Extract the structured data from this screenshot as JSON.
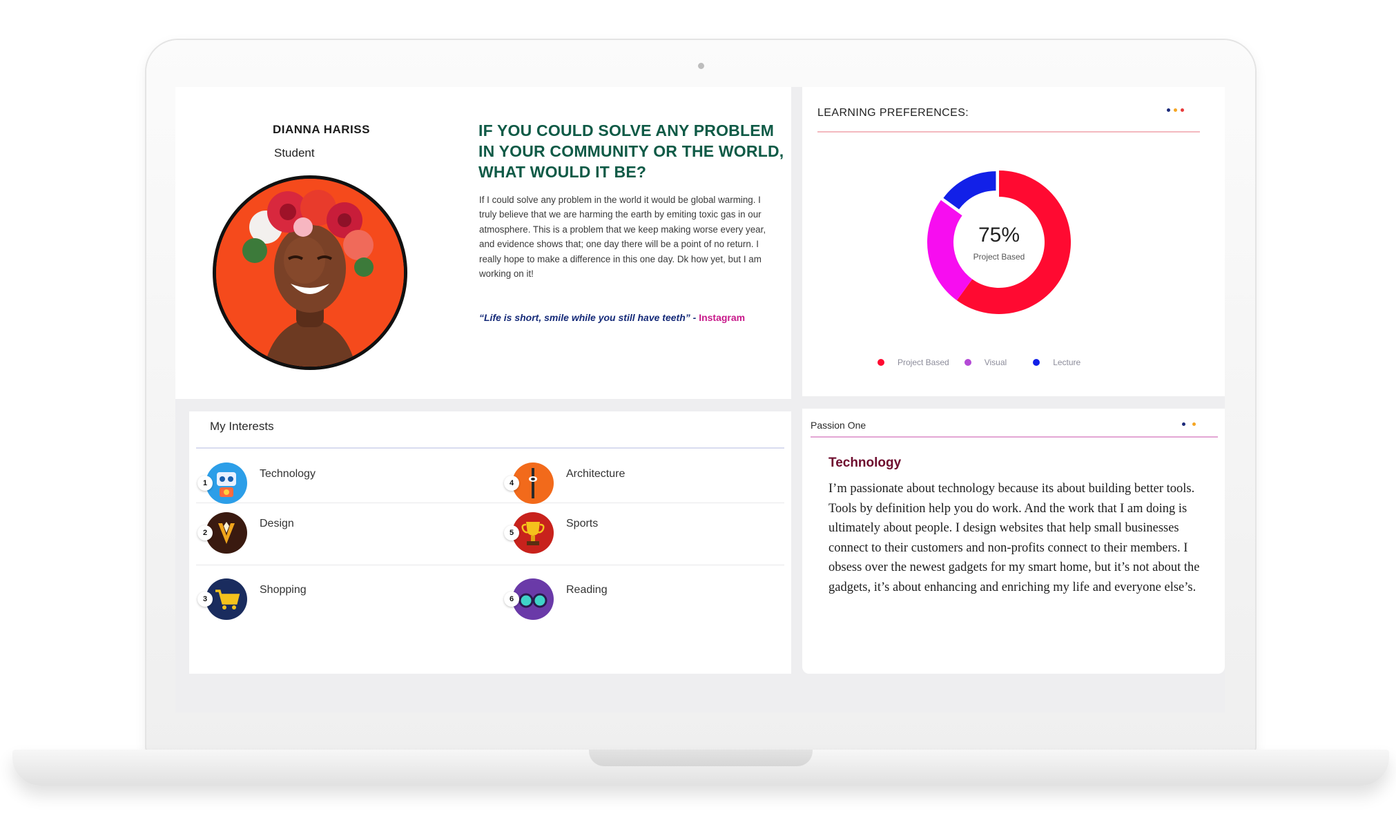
{
  "profile": {
    "name": "DIANNA HARISS",
    "role": "Student",
    "question": "IF YOU COULD SOLVE ANY PROBLEM IN YOUR COMMUNITY OR THE WORLD, WHAT WOULD IT BE?",
    "answer": "If I could solve any problem in the world it would be global warming. I truly believe that we are harming the earth by emiting toxic gas in our atmosphere. This is a problem that we keep making worse every year, and evidence shows that; one day there will be a point of no return. I really hope to make a difference in this one day. Dk how yet, but I am working on it!",
    "quote": "“Life is short, smile while you still  have teeth”",
    "quote_separator": " - ",
    "quote_source": "Instagram"
  },
  "learning": {
    "title": "LEARNING PREFERENCES:",
    "center_value": "75%",
    "center_label": "Project Based"
  },
  "chart_data": {
    "type": "pie",
    "donut": true,
    "categories": [
      "Project Based",
      "Visual",
      "Lecture"
    ],
    "values": [
      60,
      25,
      15
    ],
    "colors": [
      "#ff0a31",
      "#f70df0",
      "#1220e8"
    ],
    "center_text": "75%",
    "center_subtext": "Project Based",
    "legend": "bottom"
  },
  "interests": {
    "title": "My Interests",
    "items": [
      {
        "num": "1",
        "label": "Technology",
        "icon": "robot-icon"
      },
      {
        "num": "2",
        "label": "Design",
        "icon": "pen-nib-icon"
      },
      {
        "num": "3",
        "label": "Shopping",
        "icon": "shopping-cart-icon"
      },
      {
        "num": "4",
        "label": "Architecture",
        "icon": "tower-icon"
      },
      {
        "num": "5",
        "label": "Sports",
        "icon": "trophy-icon"
      },
      {
        "num": "6",
        "label": "Reading",
        "icon": "glasses-icon"
      }
    ]
  },
  "passion": {
    "title": "Passion One",
    "heading": "Technology",
    "text": "I’m passionate about technology because its about building better tools. Tools by definition help you do work. And the work that I am doing is ultimately about people. I design websites that help small businesses connect to their customers and non-profits connect to their members. I obsess over the newest gadgets for my smart home, but it’s not about the gadgets, it’s about enhancing and enriching my life and everyone else’s."
  },
  "colors": {
    "question": "#0f5a46",
    "quote": "#152a78",
    "quote_source": "#c8188a",
    "passion_heading": "#6e0c2e",
    "dot_navy": "#1c2a7a",
    "dot_orange": "#f5a623",
    "dot_red": "#e83a3a"
  }
}
